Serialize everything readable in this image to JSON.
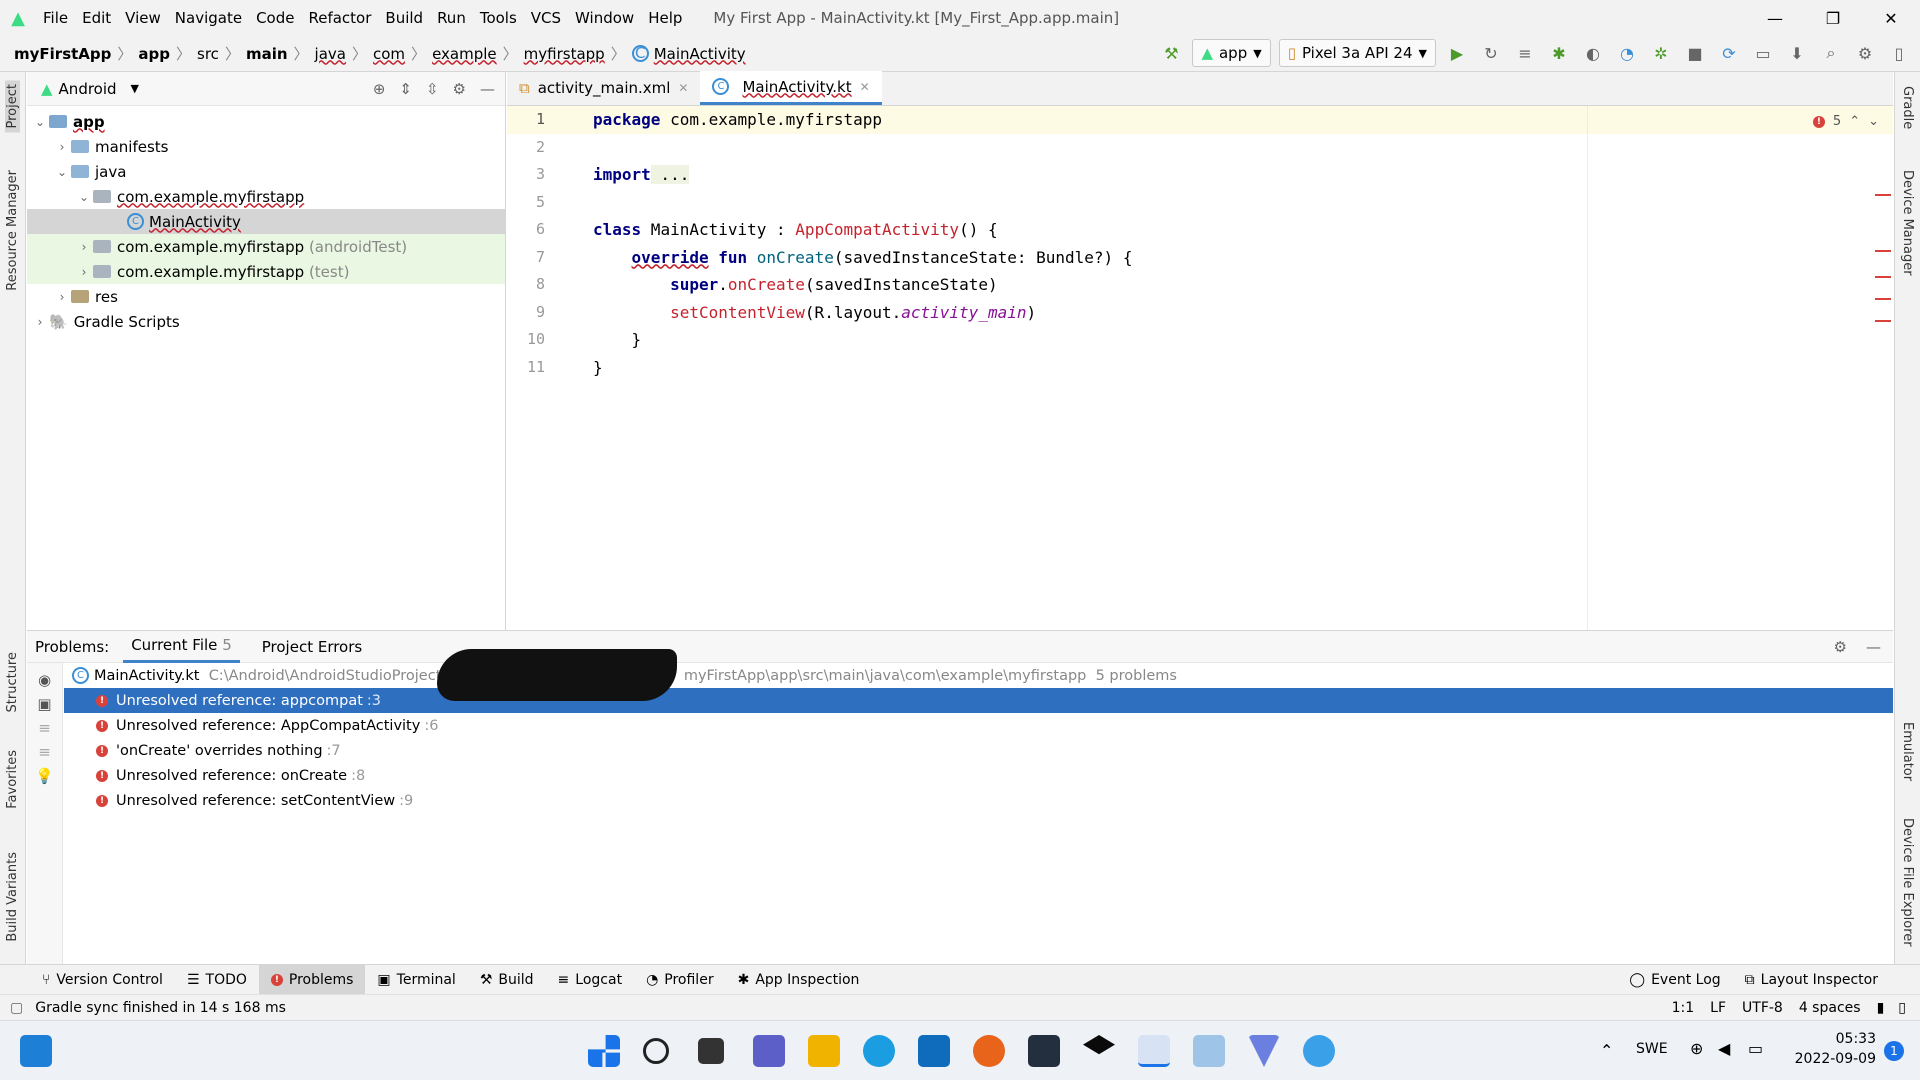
{
  "window": {
    "title": "My First App - MainActivity.kt [My_First_App.app.main]"
  },
  "menu": [
    "File",
    "Edit",
    "View",
    "Navigate",
    "Code",
    "Refactor",
    "Build",
    "Run",
    "Tools",
    "VCS",
    "Window",
    "Help"
  ],
  "breadcrumbs": [
    "myFirstApp",
    "app",
    "src",
    "main",
    "java",
    "com",
    "example",
    "myfirstapp",
    "MainActivity"
  ],
  "toolbar": {
    "config": "app",
    "device": "Pixel 3a API 24"
  },
  "project": {
    "view": "Android",
    "tree": [
      {
        "label": "app",
        "bold": true
      },
      {
        "label": "manifests"
      },
      {
        "label": "java"
      },
      {
        "label": "com.example.myfirstapp"
      },
      {
        "label": "MainActivity"
      },
      {
        "label": "com.example.myfirstapp",
        "suffix": "(androidTest)"
      },
      {
        "label": "com.example.myfirstapp",
        "suffix": "(test)"
      },
      {
        "label": "res"
      },
      {
        "label": "Gradle Scripts"
      }
    ]
  },
  "editor": {
    "tabs": [
      "activity_main.xml",
      "MainActivity.kt"
    ],
    "error_count": "5",
    "lines": [
      "1",
      "2",
      "3",
      "5",
      "6",
      "7",
      "8",
      "9",
      "10",
      "11"
    ]
  },
  "code": {
    "l1a": "package",
    "l1b": " com.example.myfirstapp",
    "l3a": "import",
    "l3b": " ...",
    "l6a": "class",
    "l6b": " MainActivity : ",
    "l6c": "AppCompatActivity",
    "l6d": "() {",
    "l7a": "override",
    "l7b": " fun ",
    "l7c": "onCreate",
    "l7d": "(savedInstanceState: Bundle?) {",
    "l8a": "super",
    "l8b": ".",
    "l8c": "onCreate",
    "l8d": "(savedInstanceState)",
    "l9a": "setContentView",
    "l9b": "(R.layout.",
    "l9c": "activity_main",
    "l9d": ")",
    "l10": "}",
    "l11": "}"
  },
  "problems": {
    "label": "Problems:",
    "tab_current": "Current File",
    "tab_current_count": "5",
    "tab_project": "Project Errors",
    "file": "MainActivity.kt",
    "path_a": "C:\\Android\\AndroidStudioProjects\\",
    "path_b": "myFirstApp\\app\\src\\main\\java\\com\\example\\myfirstapp",
    "summary": "5 problems",
    "items": [
      {
        "text": "Unresolved reference: appcompat",
        "loc": ":3"
      },
      {
        "text": "Unresolved reference: AppCompatActivity",
        "loc": ":6"
      },
      {
        "text": "'onCreate' overrides nothing",
        "loc": ":7"
      },
      {
        "text": "Unresolved reference: onCreate",
        "loc": ":8"
      },
      {
        "text": "Unresolved reference: setContentView",
        "loc": ":9"
      }
    ]
  },
  "bottom_tools": [
    "Version Control",
    "TODO",
    "Problems",
    "Terminal",
    "Build",
    "Logcat",
    "Profiler",
    "App Inspection",
    "Event Log",
    "Layout Inspector"
  ],
  "status": {
    "message": "Gradle sync finished in 14 s 168 ms",
    "position": "1:1",
    "line_ending": "LF",
    "encoding": "UTF-8",
    "indent": "4 spaces"
  },
  "side": {
    "left": [
      "Project",
      "Resource Manager",
      "Structure",
      "Favorites",
      "Build Variants"
    ],
    "right": [
      "Gradle",
      "Device Manager",
      "Emulator",
      "Device File Explorer"
    ]
  },
  "taskbar": {
    "lang": "SWE",
    "time": "05:33",
    "date": "2022-09-09",
    "notif": "1"
  }
}
